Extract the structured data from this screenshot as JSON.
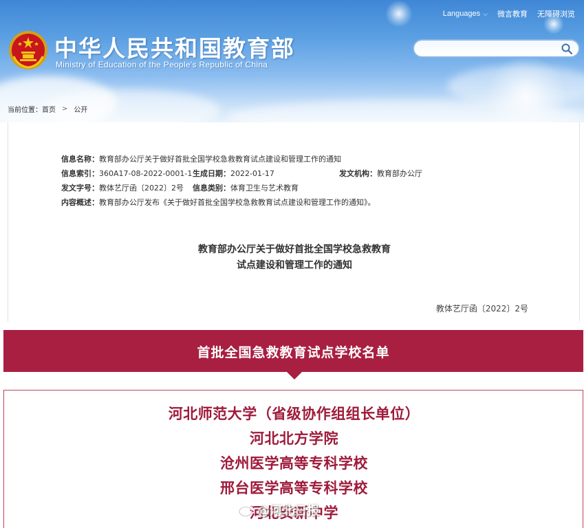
{
  "header": {
    "ministry_cn": "中华人民共和国教育部",
    "ministry_en": "Ministry of Education of the People's Republic of China",
    "languages_label": "Languages",
    "wechat_label": "微言教育",
    "accessibility_label": "无障碍浏览",
    "search_placeholder": ""
  },
  "breadcrumb": {
    "prefix": "当前位置：",
    "home": "首页",
    "current": "公开"
  },
  "document": {
    "info_name_label": "信息名称：",
    "info_name_value": "教育部办公厅关于做好首批全国学校急救教育试点建设和管理工作的通知",
    "info_index_label": "信息索引：",
    "info_index_value": "360A17-08-2022-0001-1",
    "created_date_label": "生成日期：",
    "created_date_value": "2022-01-17",
    "issuer_label": "发文机构：",
    "issuer_value": "教育部办公厅",
    "doc_number_label": "发文字号：",
    "doc_number_value": "教体艺厅函〔2022〕2号",
    "category_label": "信息类别：",
    "category_value": "体育卫生与艺术教育",
    "summary_label": "内容概述：",
    "summary_value": "教育部办公厅发布《关于做好首批全国学校急救教育试点建设和管理工作的通知》。",
    "title_line1": "教育部办公厅关于做好首批全国学校急救教育",
    "title_line2": "试点建设和管理工作的通知",
    "doc_number_display": "教体艺厅函〔2022〕2号"
  },
  "banner": {
    "title": "首批全国急救教育试点学校名单"
  },
  "schools": [
    "河北师范大学（省级协作组组长单位）",
    "河北北方学院",
    "沧州医学高等专科学校",
    "邢台医学高等专科学校",
    "河北安新中学"
  ],
  "watermark": {
    "text": "@河北日报"
  },
  "colors": {
    "banner": "#a81f41",
    "school_text": "#9e1a3a",
    "header_blue": "#3f87d6"
  }
}
